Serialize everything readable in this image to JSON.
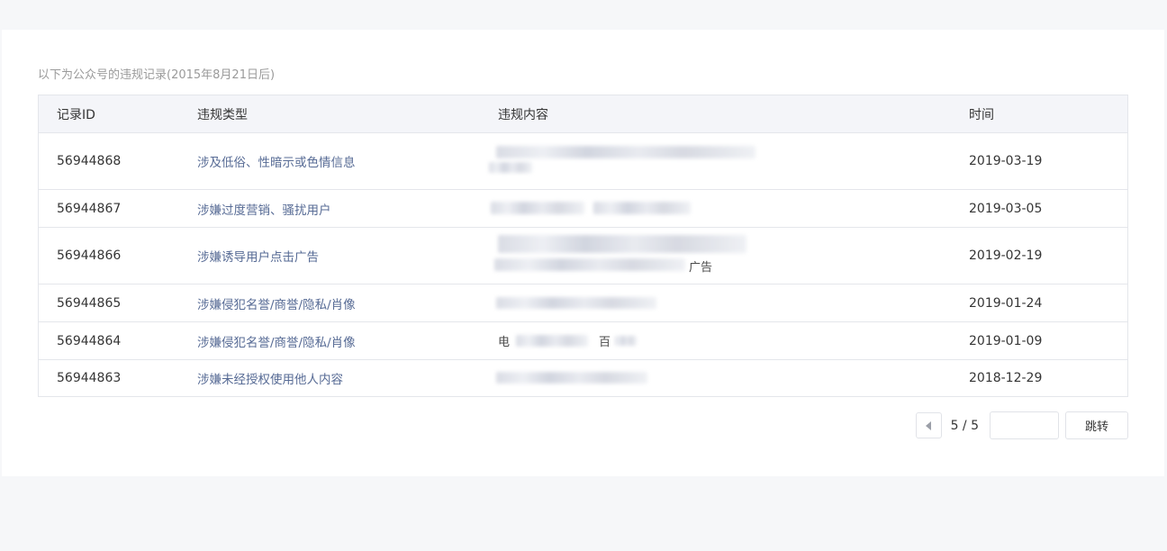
{
  "intro_text": "以下为公众号的违规记录(2015年8月21日后)",
  "table": {
    "headers": {
      "id": "记录ID",
      "type": "违规类型",
      "content": "违规内容",
      "time": "时间"
    },
    "rows": [
      {
        "id": "56944868",
        "type": "涉及低俗、性暗示或色情信息",
        "time": "2019-03-19",
        "content_fragments": []
      },
      {
        "id": "56944867",
        "type": "涉嫌过度营销、骚扰用户",
        "time": "2019-03-05",
        "content_fragments": []
      },
      {
        "id": "56944866",
        "type": "涉嫌诱导用户点击广告",
        "time": "2019-02-19",
        "content_fragments": [
          "广告"
        ]
      },
      {
        "id": "56944865",
        "type": "涉嫌侵犯名誉/商誉/隐私/肖像",
        "time": "2019-01-24",
        "content_fragments": []
      },
      {
        "id": "56944864",
        "type": "涉嫌侵犯名誉/商誉/隐私/肖像",
        "time": "2019-01-09",
        "content_fragments": [
          "电",
          "百"
        ]
      },
      {
        "id": "56944863",
        "type": "涉嫌未经授权使用他人内容",
        "time": "2018-12-29",
        "content_fragments": []
      }
    ]
  },
  "pagination": {
    "page_label": "5 / 5",
    "jump_value": "",
    "jump_label": "跳转"
  }
}
